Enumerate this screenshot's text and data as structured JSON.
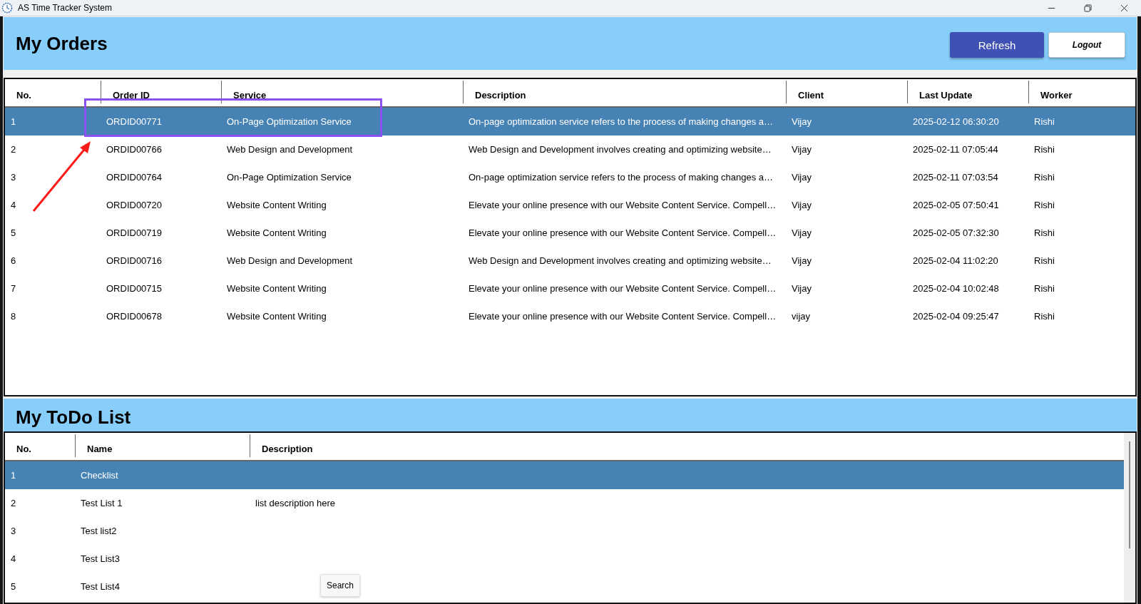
{
  "window": {
    "title": "AS Time Tracker System"
  },
  "orders": {
    "title": "My Orders",
    "buttons": [
      {
        "label": "Refresh",
        "kind": "primary"
      },
      {
        "label": "Logout",
        "kind": "secondary"
      }
    ],
    "columns": [
      "No.",
      "Order ID",
      "Service",
      "Description",
      "Client",
      "Last Update",
      "Worker"
    ],
    "rows": [
      {
        "cells": [
          "1",
          "ORDID00771",
          "On-Page Optimization Service",
          "On-page optimization service refers to the process of making changes a…",
          "Vijay",
          "2025-02-12 06:30:20",
          "Rishi"
        ],
        "selected": true
      },
      {
        "cells": [
          "2",
          "ORDID00766",
          "Web Design and Development",
          "Web Design and Development involves creating and optimizing website…",
          "Vijay",
          "2025-02-11 07:05:44",
          "Rishi"
        ],
        "selected": false
      },
      {
        "cells": [
          "3",
          "ORDID00764",
          "On-Page Optimization Service",
          "On-page optimization service refers to the process of making changes a…",
          "Vijay",
          "2025-02-11 07:03:54",
          "Rishi"
        ],
        "selected": false
      },
      {
        "cells": [
          "4",
          "ORDID00720",
          "Website Content Writing",
          "Elevate your online presence with our Website Content Service. Compell…",
          "Vijay",
          "2025-02-05 07:50:41",
          "Rishi"
        ],
        "selected": false
      },
      {
        "cells": [
          "5",
          "ORDID00719",
          "Website Content Writing",
          "Elevate your online presence with our Website Content Service. Compell…",
          "Vijay",
          "2025-02-05 07:32:30",
          "Rishi"
        ],
        "selected": false
      },
      {
        "cells": [
          "6",
          "ORDID00716",
          "Web Design and Development",
          "Web Design and Development involves creating and optimizing website…",
          "Vijay",
          "2025-02-04 11:02:20",
          "Rishi"
        ],
        "selected": false
      },
      {
        "cells": [
          "7",
          "ORDID00715",
          "Website Content Writing",
          "Elevate your online presence with our Website Content Service. Compell…",
          "Vijay",
          "2025-02-04 10:02:48",
          "Rishi"
        ],
        "selected": false
      },
      {
        "cells": [
          "8",
          "ORDID00678",
          "Website Content Writing",
          "Elevate your online presence with our Website Content Service. Compell…",
          "vijay",
          "2025-02-04 09:25:47",
          "Rishi"
        ],
        "selected": false
      }
    ]
  },
  "todo": {
    "title": "My ToDo List",
    "columns": [
      "No.",
      "Name",
      "Description"
    ],
    "rows": [
      {
        "cells": [
          "1",
          "Checklist",
          ""
        ],
        "selected": true
      },
      {
        "cells": [
          "2",
          "Test List 1",
          "list description here"
        ],
        "selected": false
      },
      {
        "cells": [
          "3",
          "Test list2",
          ""
        ],
        "selected": false
      },
      {
        "cells": [
          "4",
          "Test List3",
          ""
        ],
        "selected": false
      },
      {
        "cells": [
          "5",
          "Test List4",
          ""
        ],
        "selected": false
      }
    ]
  },
  "tooltip": {
    "text": "Search"
  }
}
